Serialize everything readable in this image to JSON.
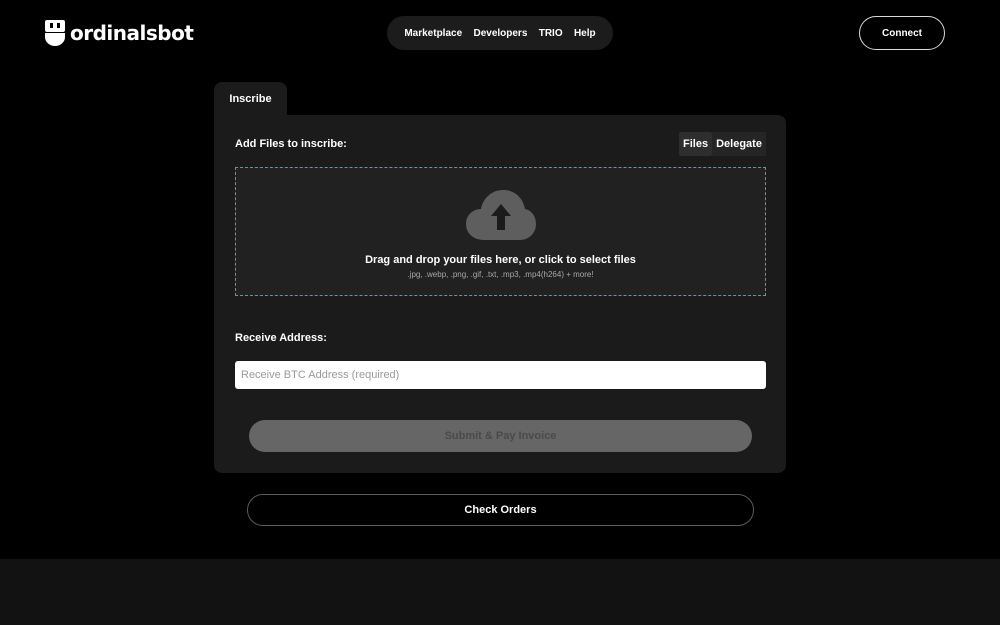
{
  "header": {
    "brand": "ordinalsbot",
    "logo_icon": "robot-head-icon",
    "nav": [
      {
        "label": "Marketplace"
      },
      {
        "label": "Developers"
      },
      {
        "label": "TRIO"
      },
      {
        "label": "Help"
      }
    ],
    "connect_label": "Connect"
  },
  "tab": {
    "label": "Inscribe"
  },
  "form": {
    "files_label": "Add Files to inscribe:",
    "mode_options": [
      {
        "label": "Files",
        "active": true
      },
      {
        "label": "Delegate",
        "active": false
      }
    ],
    "dropzone": {
      "icon": "cloud-upload-icon",
      "title": "Drag and drop your files here, or click to select files",
      "subtitle": ".jpg, .webp, .png, .gif, .txt, .mp3, .mp4(h264) + more!"
    },
    "address_label": "Receive Address:",
    "address_placeholder": "Receive BTC Address (required)",
    "address_value": "",
    "submit_label": "Submit & Pay Invoice"
  },
  "check_orders_label": "Check Orders",
  "colors": {
    "background": "#000000",
    "panel": "#1b1b1b",
    "dropzone_border": "#3fa9a6",
    "submit_disabled": "#666666"
  }
}
